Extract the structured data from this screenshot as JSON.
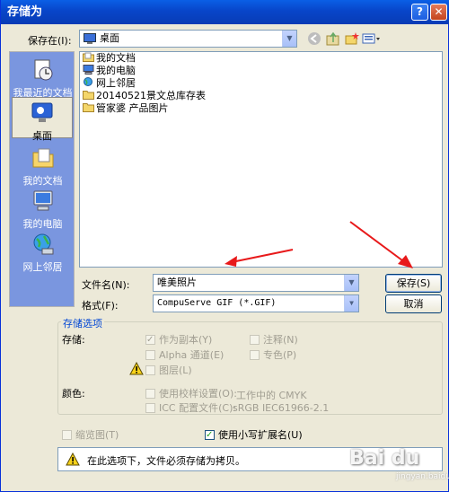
{
  "window": {
    "title": "存储为",
    "help": "?",
    "close": "✕"
  },
  "save_in": {
    "label": "保存在(I):",
    "value": "桌面"
  },
  "places": [
    {
      "label": "我最近的文档",
      "icon": "recent-documents-icon"
    },
    {
      "label": "桌面",
      "icon": "desktop-icon",
      "selected": true
    },
    {
      "label": "我的文档",
      "icon": "my-documents-icon"
    },
    {
      "label": "我的电脑",
      "icon": "my-computer-icon"
    },
    {
      "label": "网上邻居",
      "icon": "network-places-icon"
    }
  ],
  "files": [
    {
      "name": "我的文档",
      "icon": "folder-documents-icon"
    },
    {
      "name": "我的电脑",
      "icon": "computer-icon"
    },
    {
      "name": "网上邻居",
      "icon": "network-icon"
    },
    {
      "name": "20140521景文总库存表",
      "icon": "folder-icon"
    },
    {
      "name": "管家婆 产品图片",
      "icon": "folder-icon"
    }
  ],
  "filename": {
    "label": "文件名(N):",
    "value": "唯美照片"
  },
  "format": {
    "label": "格式(F):",
    "value": "CompuServe GIF (*.GIF)"
  },
  "buttons": {
    "save": "保存(S)",
    "cancel": "取消"
  },
  "options": {
    "group_title": "存储选项",
    "store_label": "存储:",
    "as_copy": "作为副本(Y)",
    "notes": "注释(N)",
    "alpha": "Alpha 通道(E)",
    "spot": "专色(P)",
    "layers": "图层(L)",
    "color_label": "颜色:",
    "use_proof": "使用校样设置(O):",
    "proof_value": "工作中的 CMYK",
    "icc": "ICC 配置文件(C):",
    "icc_value": "sRGB IEC61966-2.1"
  },
  "thumbnail": "缩览图(T)",
  "lowercase_ext": "使用小写扩展名(U)",
  "warning": "在此选项下，文件必须存储为拷贝。",
  "watermark": {
    "main": "Bai du",
    "sub": "jingyan.baidu.com"
  },
  "colors": {
    "title_bar": "#0845c9",
    "places_bar": "#7a96df",
    "dialog": "#ece9d8",
    "arrow": "#e8191a"
  }
}
